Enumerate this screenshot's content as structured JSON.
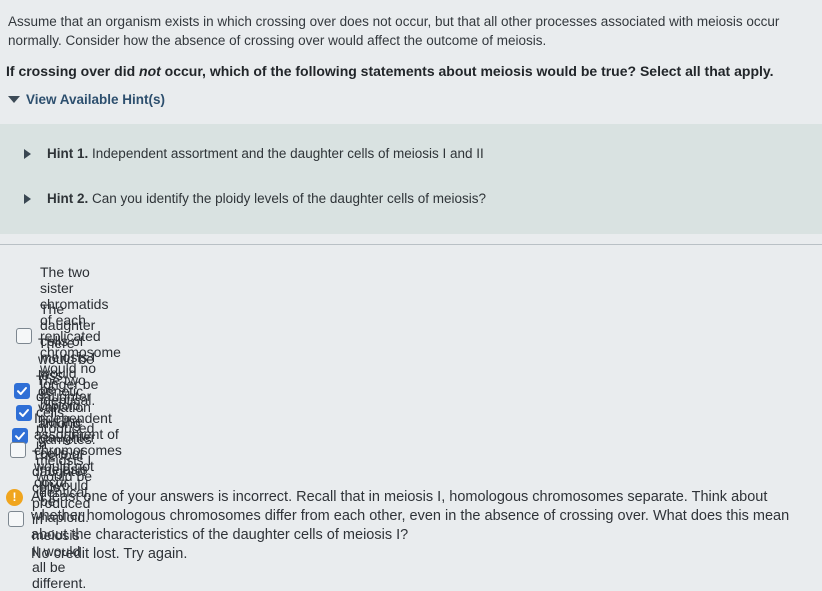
{
  "intro": "Assume that an organism exists in which crossing over does not occur, but that all other processes associated with meiosis occur normally. Consider how the absence of crossing over would affect the outcome of meiosis.",
  "question": {
    "before": "If crossing over did ",
    "emphasis": "not",
    "after": " occur, which of the following statements about meiosis would be true? Select all that apply."
  },
  "hints": {
    "toggle_label": "View Available Hint(s)",
    "items": [
      {
        "label": "Hint 1.",
        "text": "Independent assortment and the daughter cells of meiosis I and II"
      },
      {
        "label": "Hint 2.",
        "text": "Can you identify the ploidy levels of the daughter cells of meiosis?"
      }
    ]
  },
  "options": [
    {
      "text": "The two sister chromatids of each replicated chromosome would no longer be identical.",
      "checked": false
    },
    {
      "text": "The daughter cells of meiosis I would be diploid, but the daughter cells of meiosis II would be haploid.",
      "checked": true
    },
    {
      "text": "There would be less genetic variation among gametes.",
      "checked": true
    },
    {
      "text": "The two daughter cells produced in meiosis I would be identical.",
      "checked": true
    },
    {
      "text": "Independent assortment of chromosomes would not occur.",
      "checked": false
    },
    {
      "text": "The four daughter cells produced in meiosis II would all be different.",
      "checked": false
    }
  ],
  "feedback": {
    "icon": "warning-icon",
    "line1": "At least one of your answers is incorrect. Recall that in meiosis I, homologous chromosomes separate. Think about whether homologous chromosomes differ from each other, even in the absence of crossing over. What does this mean about the characteristics of the daughter cells of meiosis I?",
    "line2": "No credit lost. Try again."
  },
  "colors": {
    "check": "#2f6fd6",
    "warning": "#f0a51e",
    "hint_panel": "#d9e2e1"
  }
}
